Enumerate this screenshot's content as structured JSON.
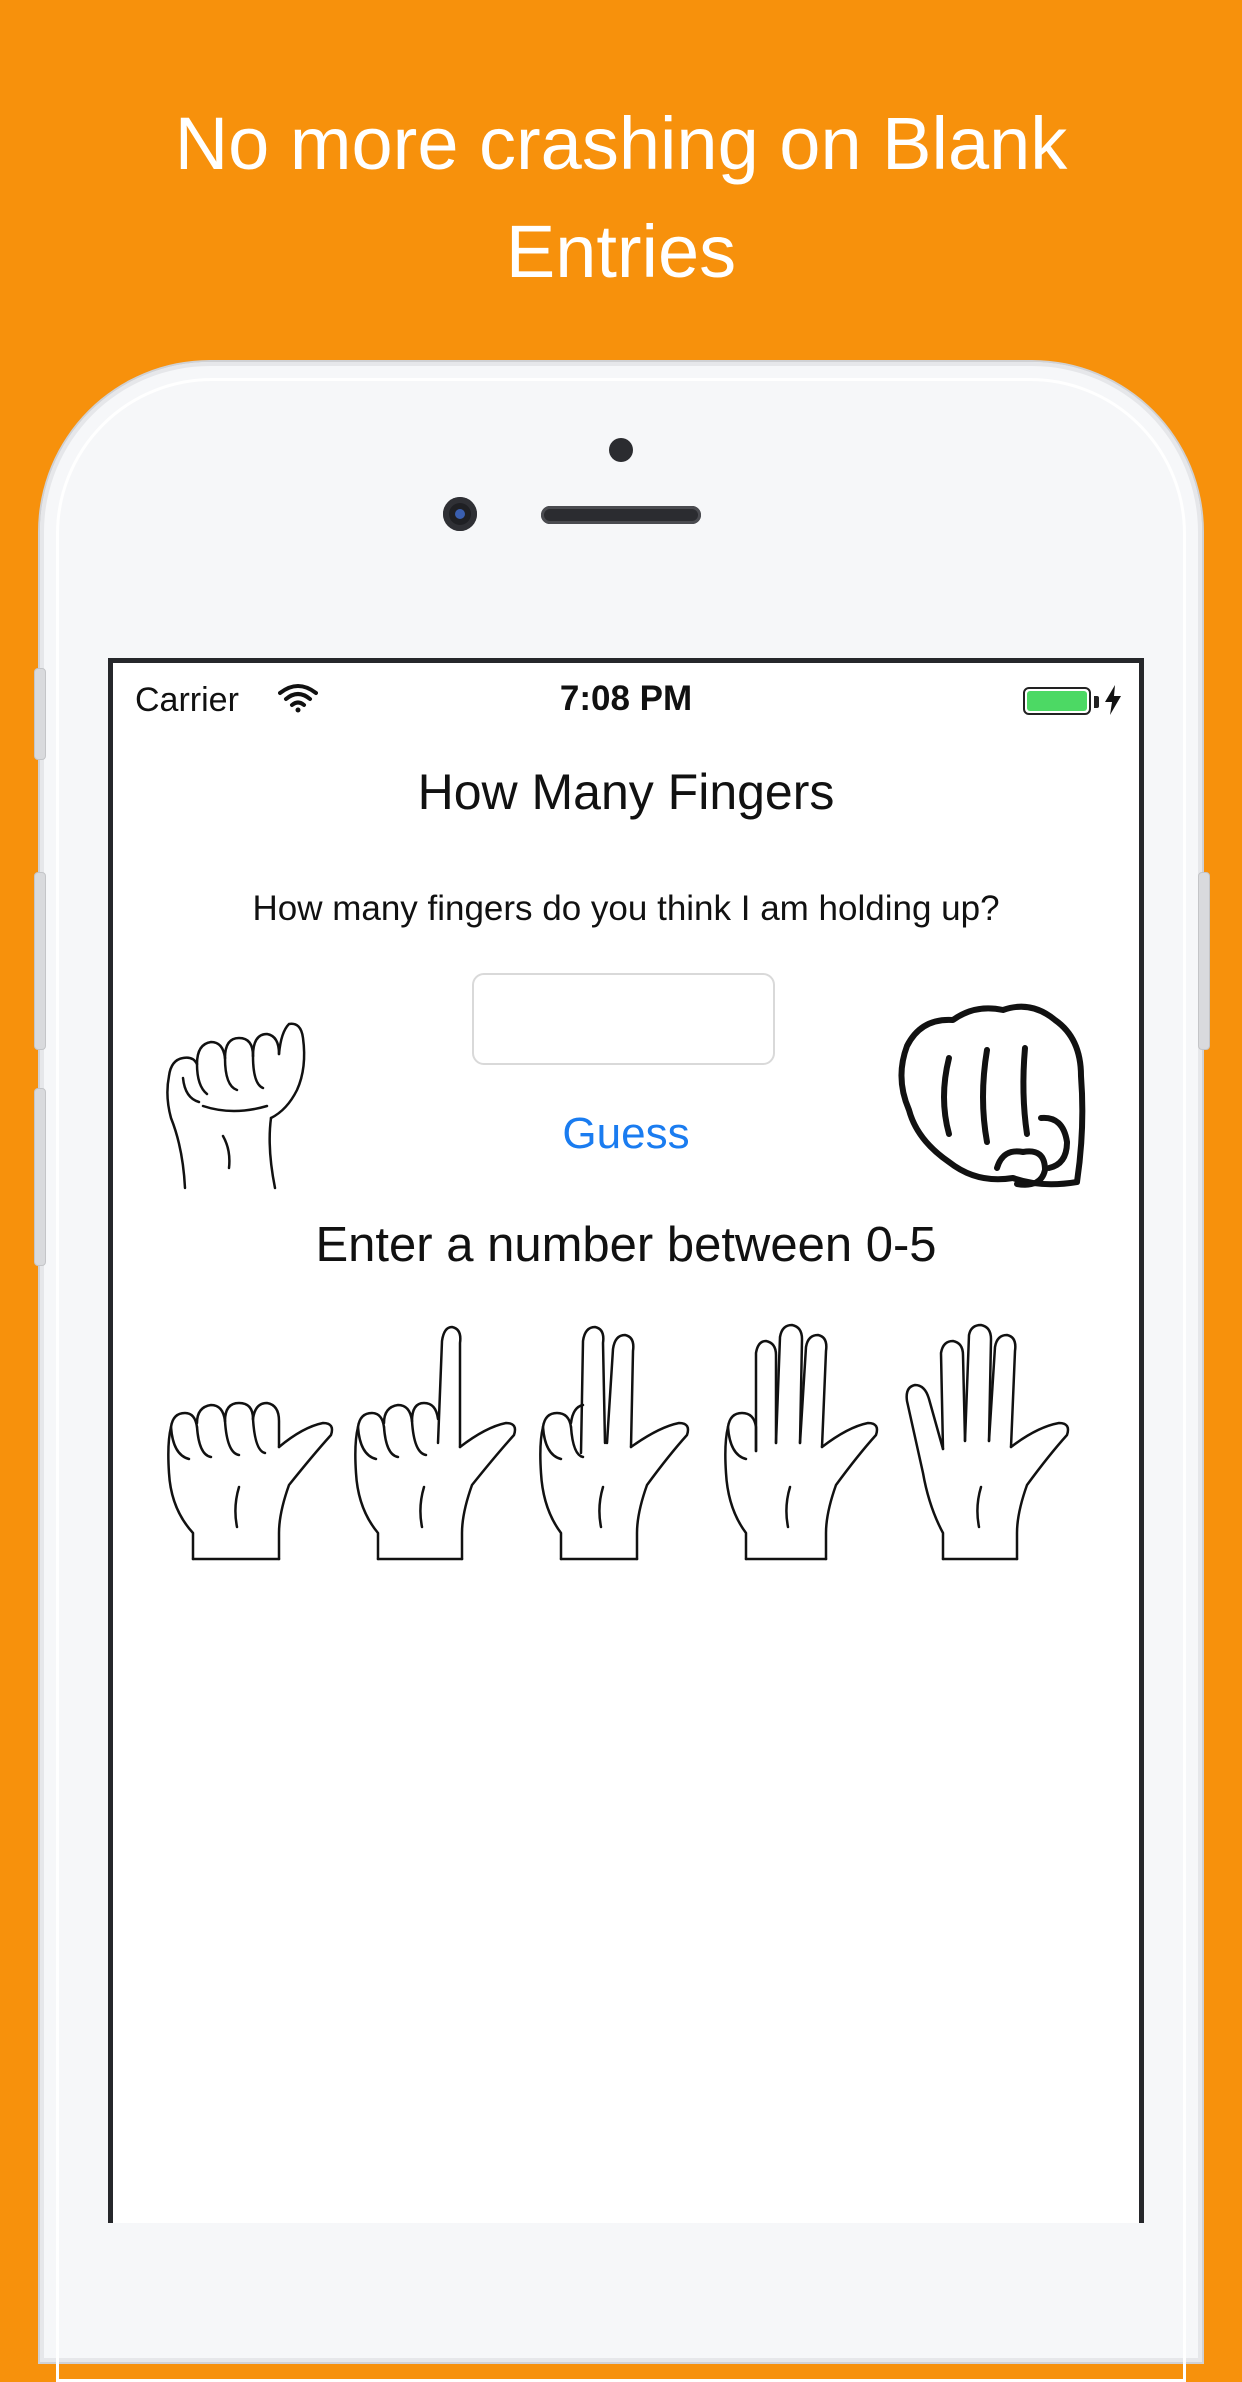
{
  "promo": {
    "line1": "No more crashing on Blank",
    "line2": "Entries"
  },
  "status_bar": {
    "carrier": "Carrier",
    "time": "7:08 PM",
    "battery_color": "#4cd964"
  },
  "app": {
    "title": "How Many Fingers",
    "question": "How many fingers do you think I am holding up?",
    "guess_input": {
      "value": "",
      "placeholder": ""
    },
    "guess_button": "Guess",
    "hint": "Enter a number between 0-5",
    "guess_color": "#1a7cf0"
  },
  "colors": {
    "background": "#f7910c"
  }
}
